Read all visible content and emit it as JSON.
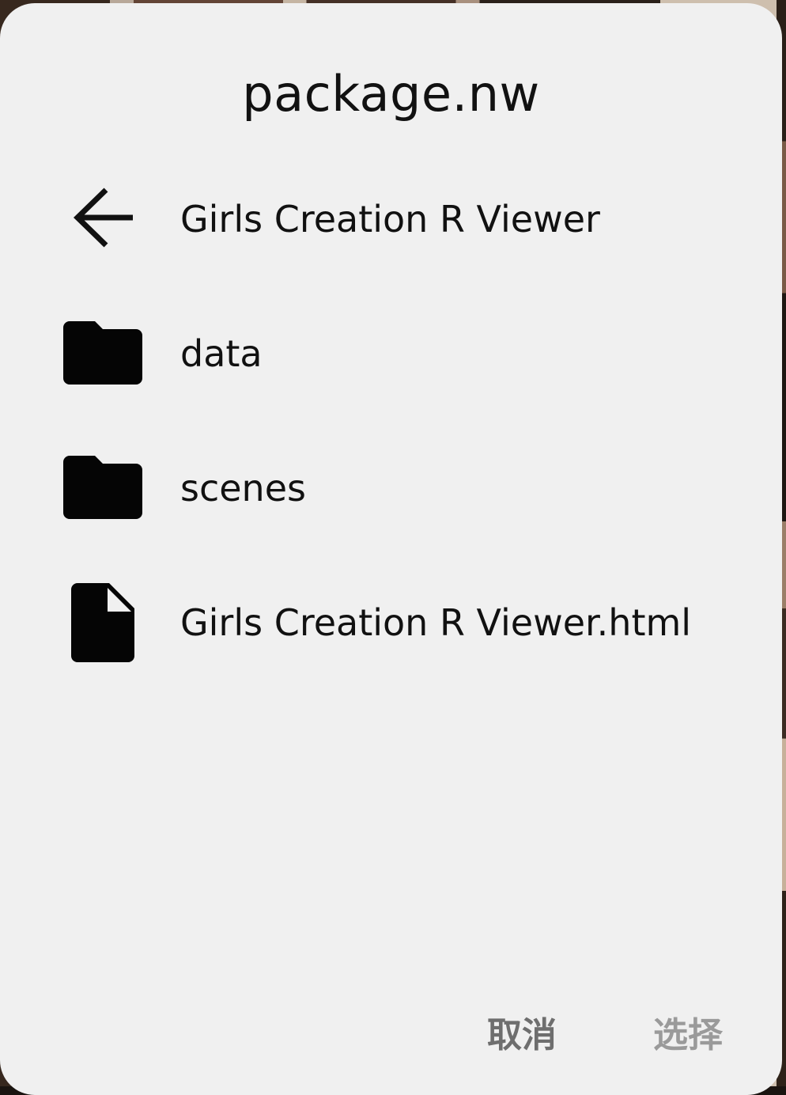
{
  "dialog": {
    "title": "package.nw",
    "entries": [
      {
        "label": "Girls Creation R Viewer",
        "icon": "back-arrow-icon"
      },
      {
        "label": "data",
        "icon": "folder-icon"
      },
      {
        "label": "scenes",
        "icon": "folder-icon"
      },
      {
        "label": "Girls Creation R Viewer.html",
        "icon": "file-icon"
      }
    ],
    "cancel_label": "取消",
    "select_label": "选择"
  },
  "colors": {
    "dialog_bg": "#f0f0f0",
    "text": "#111111",
    "cancel_text": "#6e6e6e",
    "select_text_disabled": "#9a9a9a"
  }
}
